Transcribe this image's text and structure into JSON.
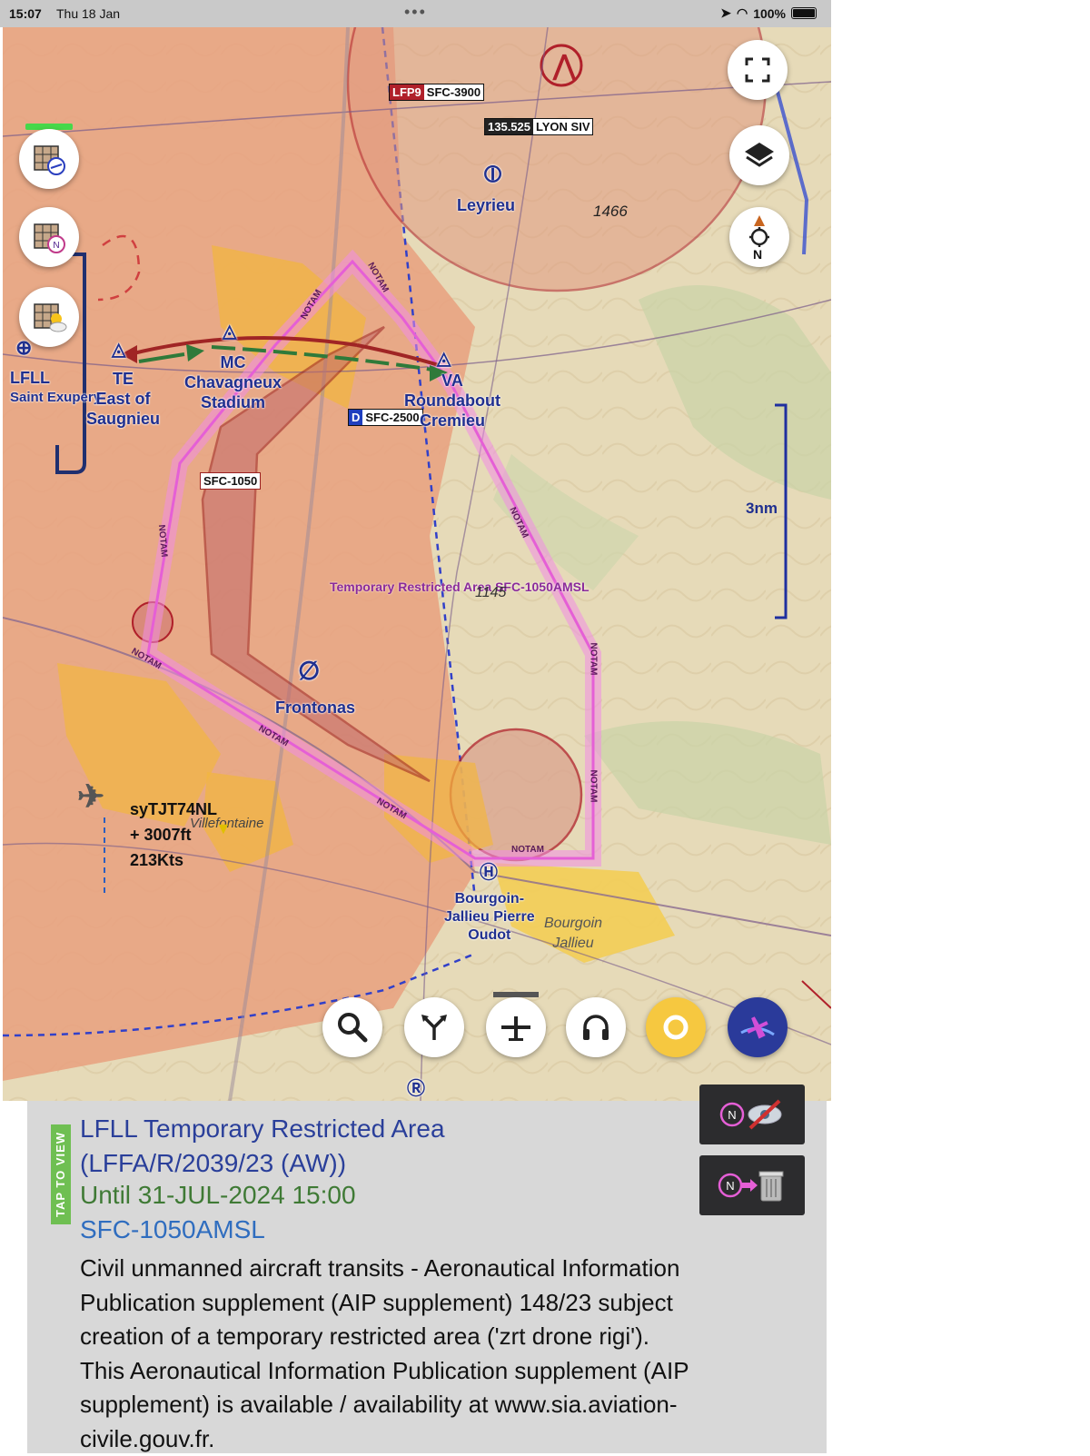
{
  "status_bar": {
    "time": "15:07",
    "date": "Thu 18 Jan",
    "battery": "100%"
  },
  "map": {
    "airspace_tags": {
      "lfp9_name": "LFP9",
      "lfp9_alt": "SFC-3900",
      "lyon_freq": "135.525",
      "lyon_name": "LYON SIV",
      "d_code": "D",
      "d_alt": "SFC-2500",
      "r_alt": "SFC-1050"
    },
    "labels": {
      "leyrieu": "Leyrieu",
      "elev_1466": "1466",
      "lfll_code": "LFLL",
      "lfll_name": "Saint Exupery",
      "te_code": "TE",
      "te_line1": "East of",
      "te_line2": "Saugnieu",
      "mc_code": "MC",
      "mc_line1": "Chavagneux",
      "mc_line2": "Stadium",
      "va_code": "VA",
      "va_line1": "Roundabout",
      "va_line2": "Cremieu",
      "frontonas": "Frontonas",
      "villefontaine": "Villefontaine",
      "bourgoin_heli_1": "Bourgoin-",
      "bourgoin_heli_2": "Jallieu Pierre",
      "bourgoin_heli_3": "Oudot",
      "bourgoin_town_1": "Bourgoin",
      "bourgoin_town_2": "Jallieu",
      "tra_label": "Temporary Restricted Area SFC-1050AMSL",
      "elev_tra": "1145",
      "scale": "3nm",
      "north": "N",
      "notam_tag": "NOTAM"
    },
    "traffic": {
      "callsign": "syTJT74NL",
      "altitude": "+ 3007ft",
      "speed": "213Kts"
    }
  },
  "notam_panel": {
    "tap_to_view": "TAP TO VIEW",
    "title": "LFLL Temporary Restricted Area  (LFFA/R/2039/23 (AW))",
    "until": "Until 31-JUL-2024 15:00",
    "altitude": "SFC-1050AMSL",
    "body": "Civil unmanned aircraft transits - Aeronautical Information Publication supplement (AIP supplement) 148/23 subject creation of a temporary restricted area ('zrt drone rigi'). This Aeronautical Information Publication supplement (AIP supplement) is available / availability at www.sia.aviation-civile.gouv.fr."
  },
  "colors": {
    "restricted_fill": "#e8a27f",
    "terrain": "#e8dcc0",
    "urban": "#f2b640",
    "notam_pink": "#e55fd6",
    "navy_label": "#1f2f8f",
    "danger_red": "#b0202a"
  }
}
